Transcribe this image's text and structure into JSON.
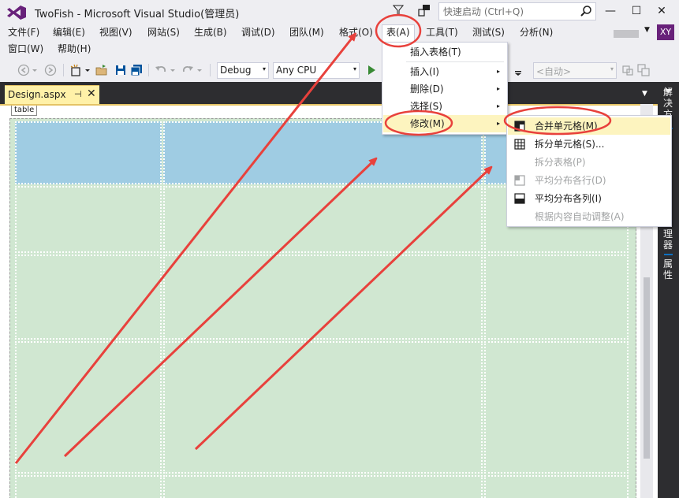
{
  "window": {
    "title": "TwoFish - Microsoft Visual Studio(管理员)",
    "quick_launch_placeholder": "快速启动 (Ctrl+Q)",
    "minimize": "—",
    "maximize": "☐",
    "close": "✕"
  },
  "menubar": {
    "items": [
      {
        "label": "文件(F)"
      },
      {
        "label": "编辑(E)"
      },
      {
        "label": "视图(V)"
      },
      {
        "label": "网站(S)"
      },
      {
        "label": "生成(B)"
      },
      {
        "label": "调试(D)"
      },
      {
        "label": "团队(M)"
      },
      {
        "label": "格式(O)"
      },
      {
        "label": "表(A)"
      },
      {
        "label": "工具(T)"
      },
      {
        "label": "测试(S)"
      },
      {
        "label": "分析(N)"
      },
      {
        "label": "窗口(W)"
      },
      {
        "label": "帮助(H)"
      }
    ],
    "account_arrow": "▼",
    "avatar": "XY"
  },
  "toolbar": {
    "configuration": "Debug",
    "platform": "Any CPU",
    "auto_combo": "<自动>",
    "dropdown_glyph": "▾"
  },
  "document": {
    "tab_label": "Design.aspx",
    "tab_pin": "⊣",
    "tab_close": "✕",
    "overflow": "▼",
    "tag_label": "table"
  },
  "table_menu": {
    "items": [
      {
        "label": "插入表格(T)"
      },
      {
        "label": "插入(I)",
        "submenu": "▸"
      },
      {
        "label": "删除(D)",
        "submenu": "▸"
      },
      {
        "label": "选择(S)",
        "submenu": "▸"
      },
      {
        "label": "修改(M)",
        "submenu": "▸"
      }
    ]
  },
  "modify_submenu": {
    "items": [
      {
        "label": "合并单元格(M)",
        "icon": "merge-cells-icon"
      },
      {
        "label": "拆分单元格(S)...",
        "icon": "split-cells-icon"
      },
      {
        "label": "拆分表格(P)"
      },
      {
        "label": "平均分布各行(D)",
        "icon": "distribute-rows-icon"
      },
      {
        "label": "平均分布各列(I)",
        "icon": "distribute-columns-icon"
      },
      {
        "label": "根据内容自动调整(A)"
      }
    ]
  },
  "right_rail": {
    "solution": "解决方",
    "manager": "理器",
    "properties": "属性"
  },
  "colors": {
    "accent": "#68217a",
    "menu_highlight": "#fdf4bf",
    "selected_cell": "#9fcce3",
    "table_cell": "#d0e7d1",
    "annotation": "#e8413c"
  }
}
